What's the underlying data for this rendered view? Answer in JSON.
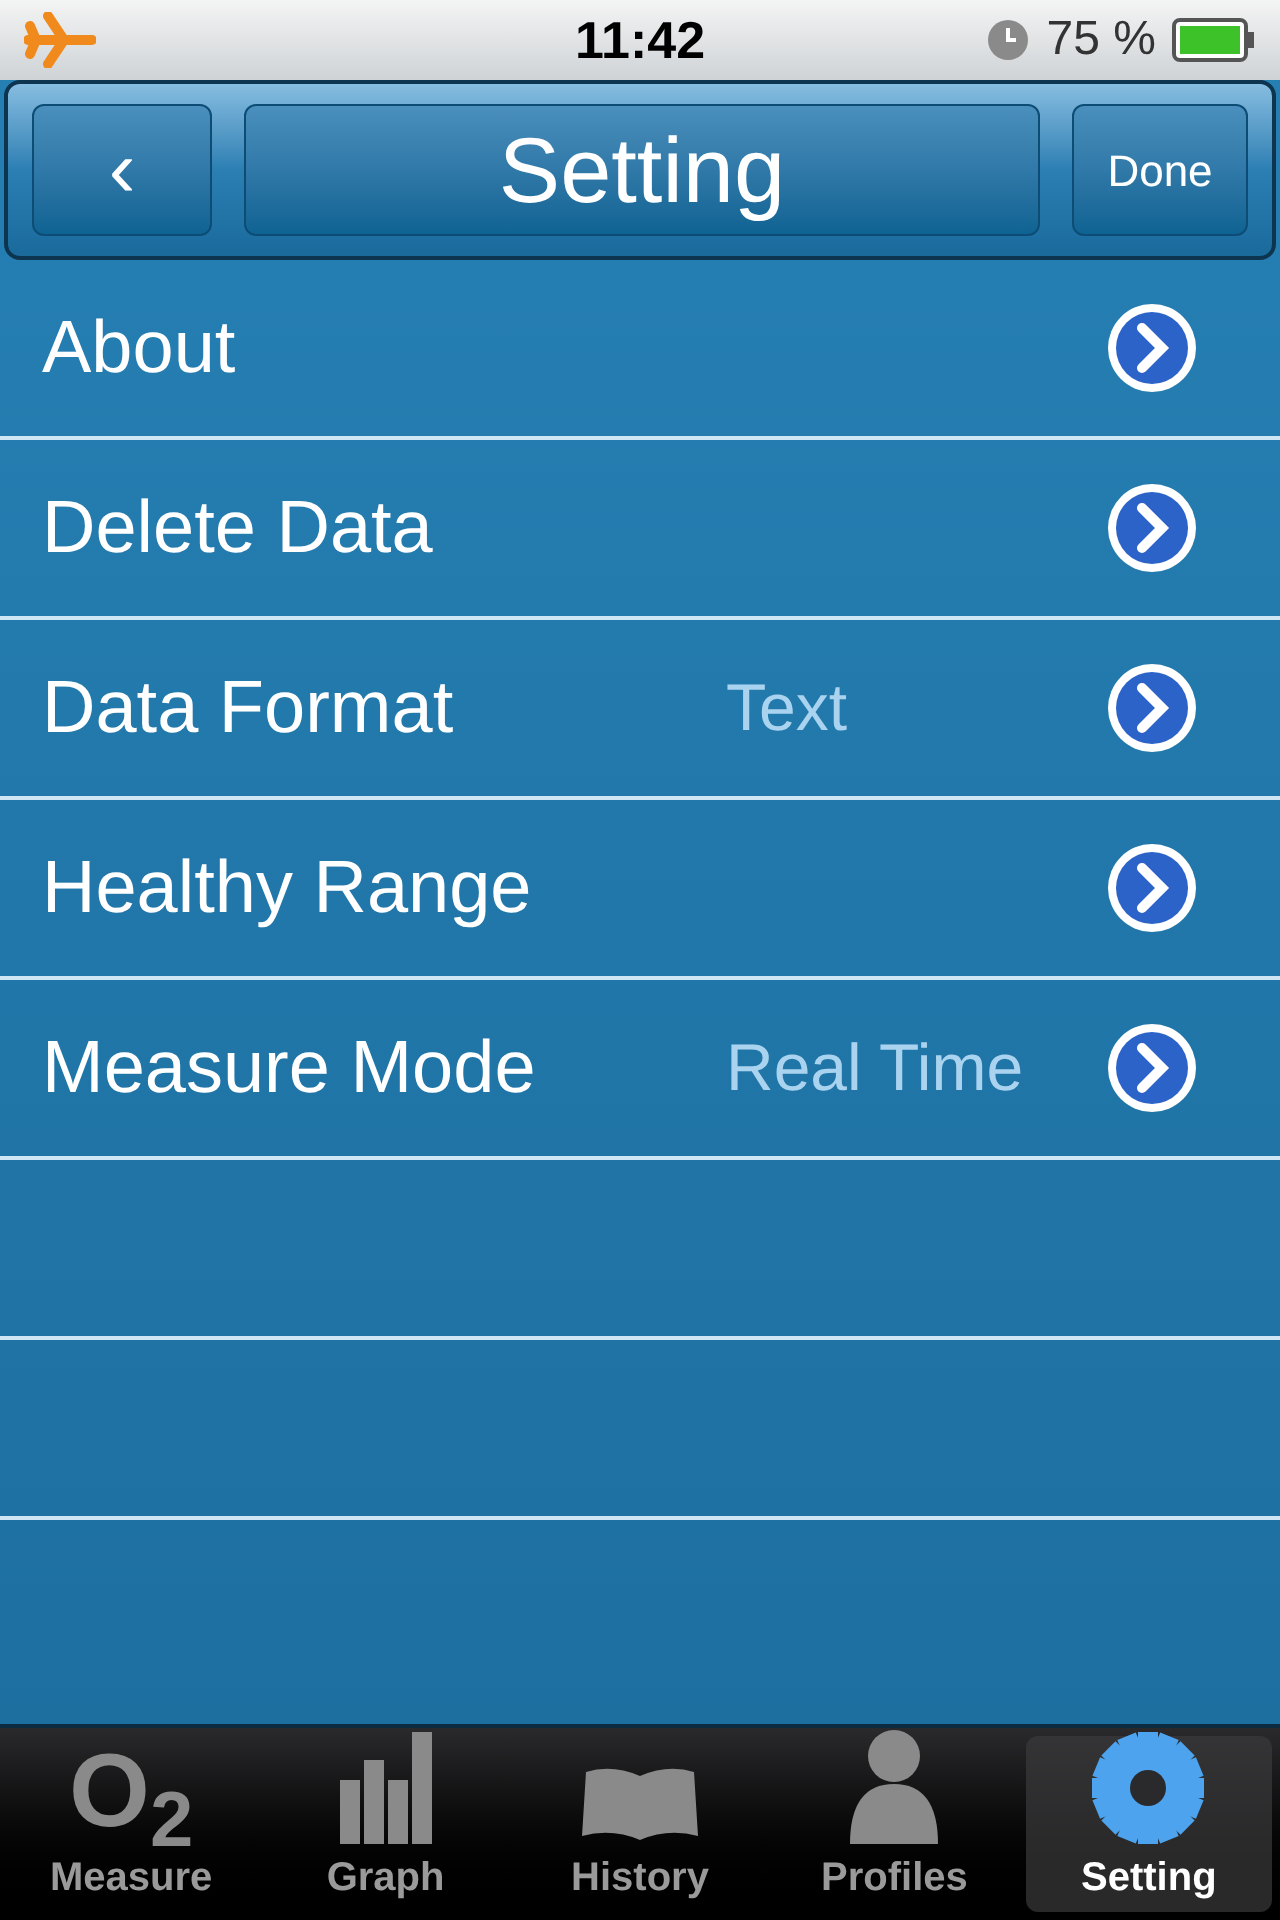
{
  "status_bar": {
    "time": "11:42",
    "battery": "75 %"
  },
  "nav_bar": {
    "back": "‹",
    "title": "Setting",
    "done": "Done"
  },
  "rows": [
    {
      "label": "About"
    },
    {
      "label": "Delete Data"
    },
    {
      "label": "Data Format",
      "value": "Text"
    },
    {
      "label": "Healthy Range"
    },
    {
      "label": "Measure Mode",
      "value": "Real Time"
    }
  ],
  "tab_bar": [
    {
      "label": "Measure",
      "kind": "o2",
      "glyph": "O$_{2}$",
      "selected": false
    },
    {
      "label": "Graph",
      "kind": "chart",
      "selected": false
    },
    {
      "label": "History",
      "kind": "book",
      "selected": false
    },
    {
      "label": "Profiles",
      "kind": "person",
      "selected": false
    },
    {
      "label": "Setting",
      "kind": "gear",
      "selected": true
    }
  ]
}
